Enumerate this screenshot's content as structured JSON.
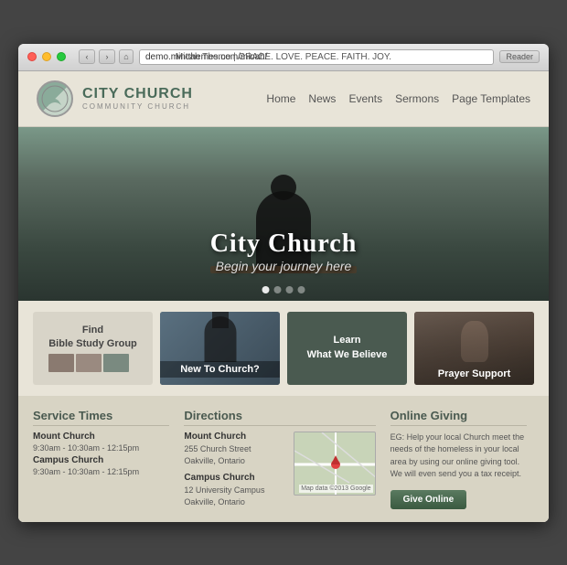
{
  "browser": {
    "title": "Micah Theme | GRACE. LOVE. PEACE. FAITH. JOY.",
    "url": "demo.mintthemes.com/micah/",
    "reader_label": "Reader"
  },
  "header": {
    "church_name": "CITY CHURCH",
    "church_sub": "COMMUNITY CHURCH",
    "nav": {
      "home": "Home",
      "news": "News",
      "events": "Events",
      "sermons": "Sermons",
      "page_templates": "Page Templates"
    }
  },
  "hero": {
    "title": "City Church",
    "subtitle": "Begin your journey here",
    "dots": 4
  },
  "features": {
    "find": {
      "line1": "Find",
      "line2": "Bible Study Group"
    },
    "new_church": "New To Church?",
    "learn": {
      "line1": "Learn",
      "line2": "What We Believe"
    },
    "prayer": "Prayer Support"
  },
  "info": {
    "service_times": {
      "title": "Service Times",
      "mount_church": {
        "name": "Mount Church",
        "times": "9:30am - 10:30am - 12:15pm"
      },
      "campus_church": {
        "name": "Campus Church",
        "times": "9:30am - 10:30am - 12:15pm"
      }
    },
    "directions": {
      "title": "Directions",
      "mount_church": {
        "name": "Mount Church",
        "address1": "255 Church Street",
        "address2": "Oakville, Ontario"
      },
      "campus_church": {
        "name": "Campus Church",
        "address1": "12 University Campus",
        "address2": "Oakville, Ontario"
      }
    },
    "online_giving": {
      "title": "Online Giving",
      "text": "EG: Help your local Church meet the needs of the homeless in your local area by using our online giving tool. We will even send you a tax receipt.",
      "button": "Give Online"
    }
  }
}
